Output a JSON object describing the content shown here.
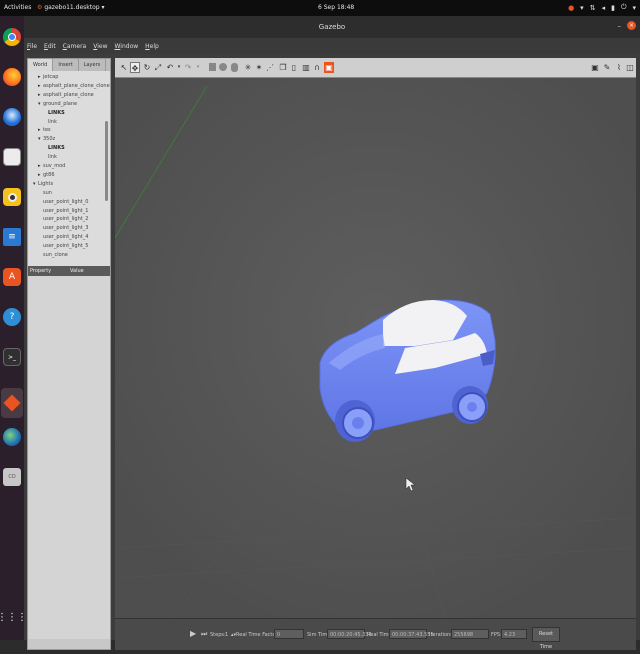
{
  "topbar": {
    "activities": "Activities",
    "app_menu": "gazebo11.desktop ▾",
    "clock": "6 Sep 18:48"
  },
  "window": {
    "title": "Gazebo"
  },
  "menu": [
    {
      "accel": "F",
      "rest": "ile"
    },
    {
      "accel": "E",
      "rest": "dit"
    },
    {
      "accel": "C",
      "rest": "amera"
    },
    {
      "accel": "V",
      "rest": "iew"
    },
    {
      "accel": "W",
      "rest": "indow"
    },
    {
      "accel": "H",
      "rest": "elp"
    }
  ],
  "left_panel": {
    "tabs": [
      "World",
      "Insert",
      "Layers"
    ],
    "tree": [
      {
        "label": "jetcap",
        "indent": 2,
        "arrow": "▸",
        "bold": false
      },
      {
        "label": "asphalt_plane_clone_clone",
        "indent": 2,
        "arrow": "▸",
        "bold": false
      },
      {
        "label": "asphalt_plane_clone",
        "indent": 2,
        "arrow": "▸",
        "bold": false
      },
      {
        "label": "ground_plane",
        "indent": 2,
        "arrow": "▾",
        "bold": false
      },
      {
        "label": "LINKS",
        "indent": 3,
        "arrow": "",
        "bold": true
      },
      {
        "label": "link",
        "indent": 3,
        "arrow": "",
        "bold": false
      },
      {
        "label": "tes",
        "indent": 2,
        "arrow": "▸",
        "bold": false
      },
      {
        "label": "350z",
        "indent": 2,
        "arrow": "▾",
        "bold": false
      },
      {
        "label": "LINKS",
        "indent": 3,
        "arrow": "",
        "bold": true
      },
      {
        "label": "link",
        "indent": 3,
        "arrow": "",
        "bold": false
      },
      {
        "label": "suv_mod",
        "indent": 2,
        "arrow": "▸",
        "bold": false
      },
      {
        "label": "gt86",
        "indent": 2,
        "arrow": "▸",
        "bold": false
      },
      {
        "label": "Lights",
        "indent": 1,
        "arrow": "▾",
        "bold": false
      },
      {
        "label": "sun",
        "indent": 2,
        "arrow": "",
        "bold": false
      },
      {
        "label": "user_point_light_0",
        "indent": 2,
        "arrow": "",
        "bold": false
      },
      {
        "label": "user_point_light_1",
        "indent": 2,
        "arrow": "",
        "bold": false
      },
      {
        "label": "user_point_light_2",
        "indent": 2,
        "arrow": "",
        "bold": false
      },
      {
        "label": "user_point_light_3",
        "indent": 2,
        "arrow": "",
        "bold": false
      },
      {
        "label": "user_point_light_4",
        "indent": 2,
        "arrow": "",
        "bold": false
      },
      {
        "label": "user_point_light_5",
        "indent": 2,
        "arrow": "",
        "bold": false
      },
      {
        "label": "sun_clone",
        "indent": 2,
        "arrow": "",
        "bold": false
      }
    ],
    "property_header": [
      "Property",
      "Value"
    ]
  },
  "status": {
    "steps_label": "Steps:",
    "steps_value": "1",
    "rtf_label": "Real Time Factor:",
    "rtf_value": "0",
    "sim_label": "Sim Time:",
    "sim_value": "00:00:20:45.334",
    "real_label": "Real Time:",
    "real_value": "00:00:37:43.555",
    "iter_label": "Iterations:",
    "iter_value": "255698",
    "fps_label": "FPS:",
    "fps_value": "4.23",
    "reset_label": "Reset Time"
  },
  "colors": {
    "car_body": "#6e86f0",
    "car_glass": "#f2f2f4",
    "viewport": "#565656",
    "ubuntu_orange": "#e95420"
  }
}
